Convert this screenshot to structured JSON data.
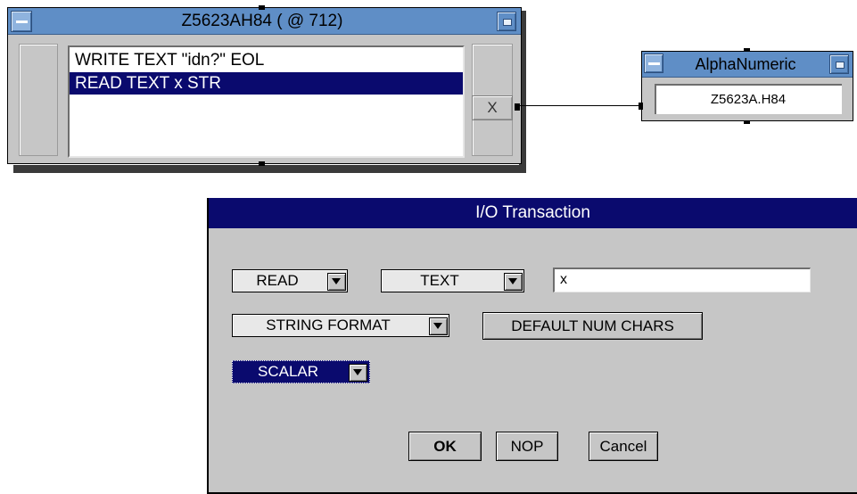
{
  "transaction_object": {
    "title": "Z5623AH84 ( @ 712)",
    "lines": [
      "WRITE TEXT \"idn?\" EOL",
      "READ TEXT x STR"
    ],
    "selected_line": 1,
    "output_pin_label": "X"
  },
  "alphanumeric": {
    "title": "AlphaNumeric",
    "value": "Z5623A.H84"
  },
  "dialog": {
    "title": "I/O Transaction",
    "action": "READ",
    "encoding": "TEXT",
    "expression": "x",
    "format": "STRING FORMAT",
    "num_chars_button": "DEFAULT NUM CHARS",
    "shape": "SCALAR",
    "ok_label": "OK",
    "nop_label": "NOP",
    "cancel_label": "Cancel"
  },
  "colors": {
    "title_bar": "#5f8ec6",
    "selection": "#0a0a6e",
    "panel": "#c6c6c6"
  }
}
